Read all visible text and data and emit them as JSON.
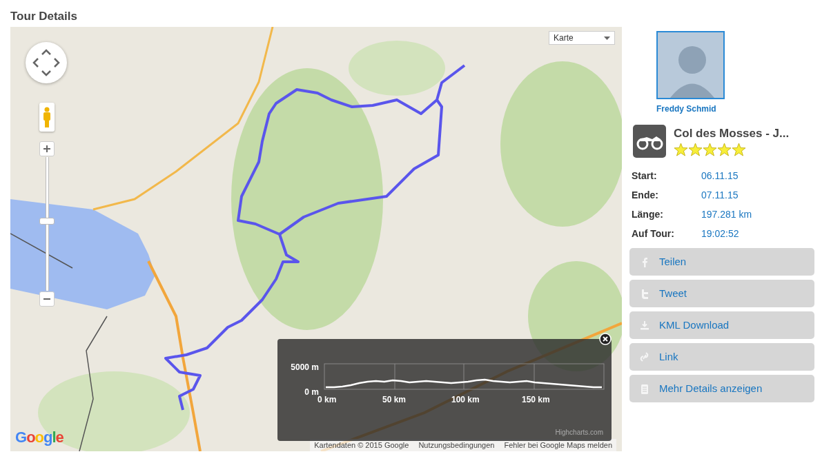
{
  "page_title": "Tour Details",
  "map": {
    "type_selector": "Karte",
    "logo": "Google",
    "zoom": {
      "level": 0.52
    },
    "footer_links": [
      "Kartendaten © 2015 Google",
      "Nutzungsbedingungen",
      "Fehler bei Google Maps melden"
    ],
    "elevation_chart": {
      "y_tick_labels": [
        "5000 m",
        "0 m"
      ],
      "x_tick_labels": [
        "0 km",
        "50 km",
        "100 km",
        "150 km"
      ],
      "credit": "Highcharts.com"
    }
  },
  "rider": {
    "name": "Freddy Schmid"
  },
  "tour": {
    "title": "Col des Mosses - J...",
    "stars": 5,
    "details": [
      {
        "label": "Start:",
        "value": "06.11.15"
      },
      {
        "label": "Ende:",
        "value": "07.11.15"
      },
      {
        "label": "Länge:",
        "value": "197.281 km"
      },
      {
        "label": "Auf Tour:",
        "value": "19:02:52"
      }
    ]
  },
  "actions": [
    {
      "kind": "share",
      "label": "Teilen"
    },
    {
      "kind": "tweet",
      "label": "Tweet"
    },
    {
      "kind": "download",
      "label": "KML Download"
    },
    {
      "kind": "link",
      "label": "Link"
    },
    {
      "kind": "details",
      "label": "Mehr Details anzeigen"
    }
  ]
}
